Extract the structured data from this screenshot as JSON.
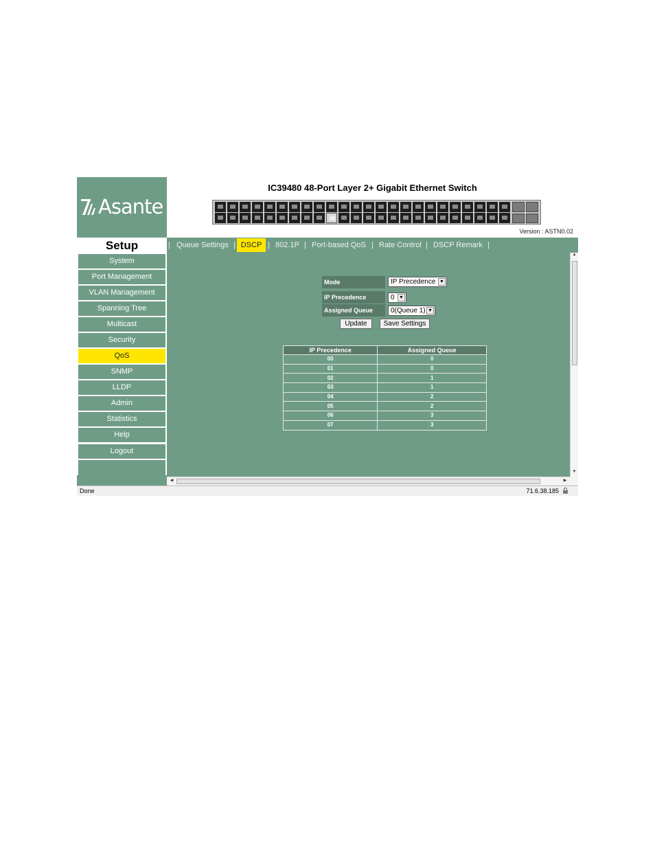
{
  "header": {
    "brand": "Asante",
    "product_title": "IC39480 48-Port Layer 2+ Gigabit Ethernet Switch",
    "version": "Version : ASTN0.02"
  },
  "sidebar": {
    "title": "Setup",
    "items": [
      {
        "label": "System"
      },
      {
        "label": "Port Management"
      },
      {
        "label": "VLAN Management"
      },
      {
        "label": "Spanning Tree"
      },
      {
        "label": "Multicast"
      },
      {
        "label": "Security"
      },
      {
        "label": "QoS",
        "active": true
      },
      {
        "label": "SNMP"
      },
      {
        "label": "LLDP"
      },
      {
        "label": "Admin"
      },
      {
        "label": "Statistics"
      },
      {
        "label": "Help"
      },
      {
        "label": "Logout"
      }
    ]
  },
  "tabs": [
    {
      "label": "Queue Settings"
    },
    {
      "label": "DSCP",
      "active": true
    },
    {
      "label": "802.1P"
    },
    {
      "label": "Port-based QoS"
    },
    {
      "label": "Rate Control"
    },
    {
      "label": "DSCP Remark"
    }
  ],
  "form": {
    "mode_label": "Mode",
    "mode_value": "IP Precedence",
    "ip_precedence_label": "IP Precedence",
    "ip_precedence_value": "0",
    "assigned_queue_label": "Assigned Queue",
    "assigned_queue_value": "0(Queue 1)",
    "update_button": "Update",
    "save_button": "Save Settings"
  },
  "mapping_table": {
    "headers": [
      "IP Precedence",
      "Assigned Queue"
    ],
    "rows": [
      [
        "00",
        "0"
      ],
      [
        "01",
        "0"
      ],
      [
        "02",
        "1"
      ],
      [
        "03",
        "1"
      ],
      [
        "04",
        "2"
      ],
      [
        "05",
        "2"
      ],
      [
        "06",
        "3"
      ],
      [
        "07",
        "3"
      ]
    ]
  },
  "status_bar": {
    "text": "Done",
    "ip": "71.6.38.185"
  },
  "colors": {
    "panel_green": "#6f9c86",
    "label_green": "#5a7a69",
    "highlight_yellow": "#ffe600"
  }
}
